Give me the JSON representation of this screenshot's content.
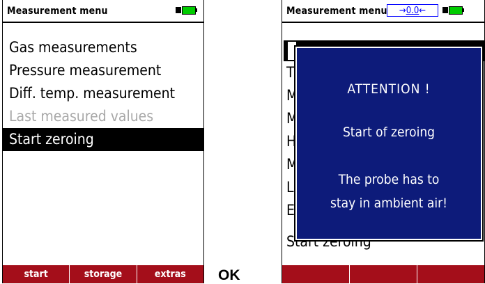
{
  "screen1": {
    "title": "Measurement menu",
    "menu": [
      {
        "label": "Gas measurements",
        "state": "normal"
      },
      {
        "label": "Pressure measurement",
        "state": "normal"
      },
      {
        "label": "Diff. temp. measurement",
        "state": "normal"
      },
      {
        "label": "Last measured values",
        "state": "disabled"
      },
      {
        "label": "Start zeroing",
        "state": "selected"
      }
    ],
    "softkeys": [
      "start",
      "storage",
      "extras"
    ]
  },
  "ok_label": "OK",
  "screen2": {
    "title": "Measurement menu",
    "zero_indicator": {
      "left_arrow": "→",
      "value": "0.0",
      "right_arrow": "←"
    },
    "dialog": {
      "heading": "ATTENTION !",
      "message": "Start of zeroing",
      "line1": "The probe has to",
      "line2": "stay in ambient air!"
    },
    "bg_letters": [
      "T",
      "M",
      "M",
      "H",
      "M",
      "L",
      "E"
    ],
    "bg_last_item": "Start zeroing"
  },
  "colors": {
    "softkey_bar": "#a40e1a",
    "dialog_bg": "#0d1b7a",
    "battery": "#00cc00",
    "zero_indicator": "#0000ff"
  }
}
